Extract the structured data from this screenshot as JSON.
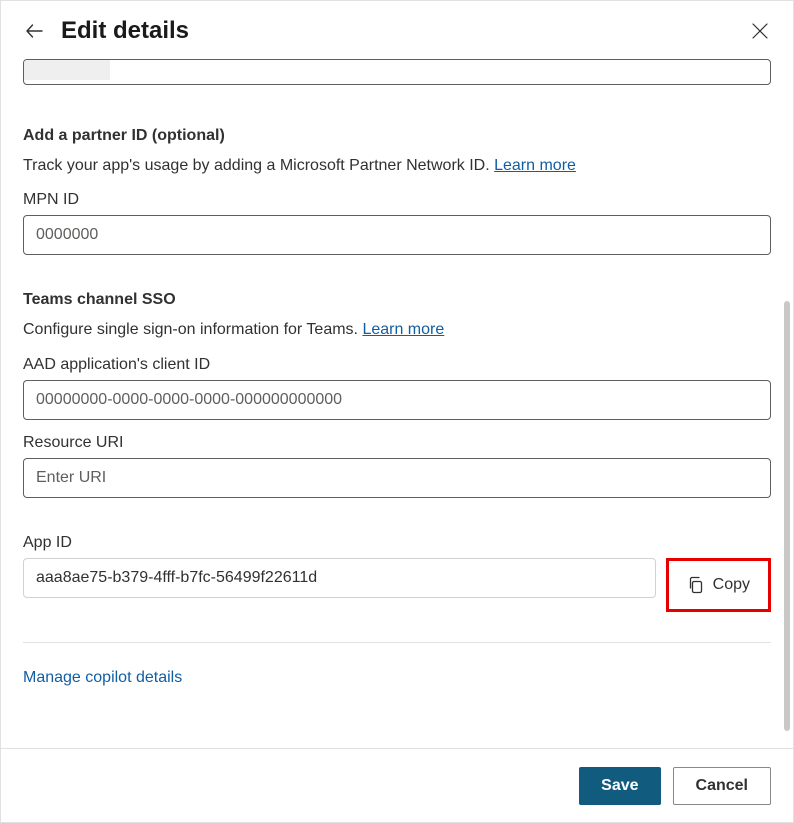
{
  "header": {
    "title": "Edit details"
  },
  "partner": {
    "heading": "Add a partner ID (optional)",
    "desc_prefix": "Track your app's usage by adding a Microsoft Partner Network ID. ",
    "learn_more": "Learn more",
    "mpn_label": "MPN ID",
    "mpn_placeholder": "0000000",
    "mpn_value": ""
  },
  "sso": {
    "heading": "Teams channel SSO",
    "desc_prefix": "Configure single sign-on information for Teams. ",
    "learn_more": "Learn more",
    "aad_label": "AAD application's client ID",
    "aad_placeholder": "00000000-0000-0000-0000-000000000000",
    "aad_value": "",
    "resource_label": "Resource URI",
    "resource_placeholder": "Enter URI",
    "resource_value": ""
  },
  "appid": {
    "label": "App ID",
    "value": "aaa8ae75-b379-4fff-b7fc-56499f22611d",
    "copy_label": "Copy"
  },
  "manage_link": "Manage copilot details",
  "footer": {
    "save": "Save",
    "cancel": "Cancel"
  }
}
